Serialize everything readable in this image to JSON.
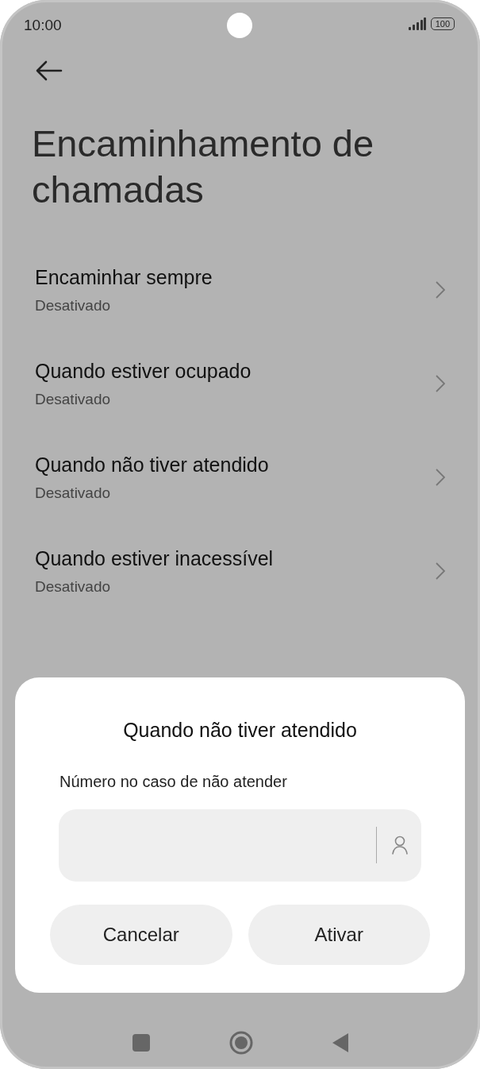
{
  "status_bar": {
    "time": "10:00",
    "battery": "100"
  },
  "title": "Encaminhamento de chamadas",
  "items": [
    {
      "title": "Encaminhar sempre",
      "subtitle": "Desativado"
    },
    {
      "title": "Quando estiver ocupado",
      "subtitle": "Desativado"
    },
    {
      "title": "Quando não tiver atendido",
      "subtitle": "Desativado"
    },
    {
      "title": "Quando estiver inacessível",
      "subtitle": "Desativado"
    }
  ],
  "dialog": {
    "title": "Quando não tiver atendido",
    "label": "Número no caso de não atender",
    "buttons": [
      {
        "label": "Cancelar"
      },
      {
        "label": "Ativar"
      }
    ]
  }
}
